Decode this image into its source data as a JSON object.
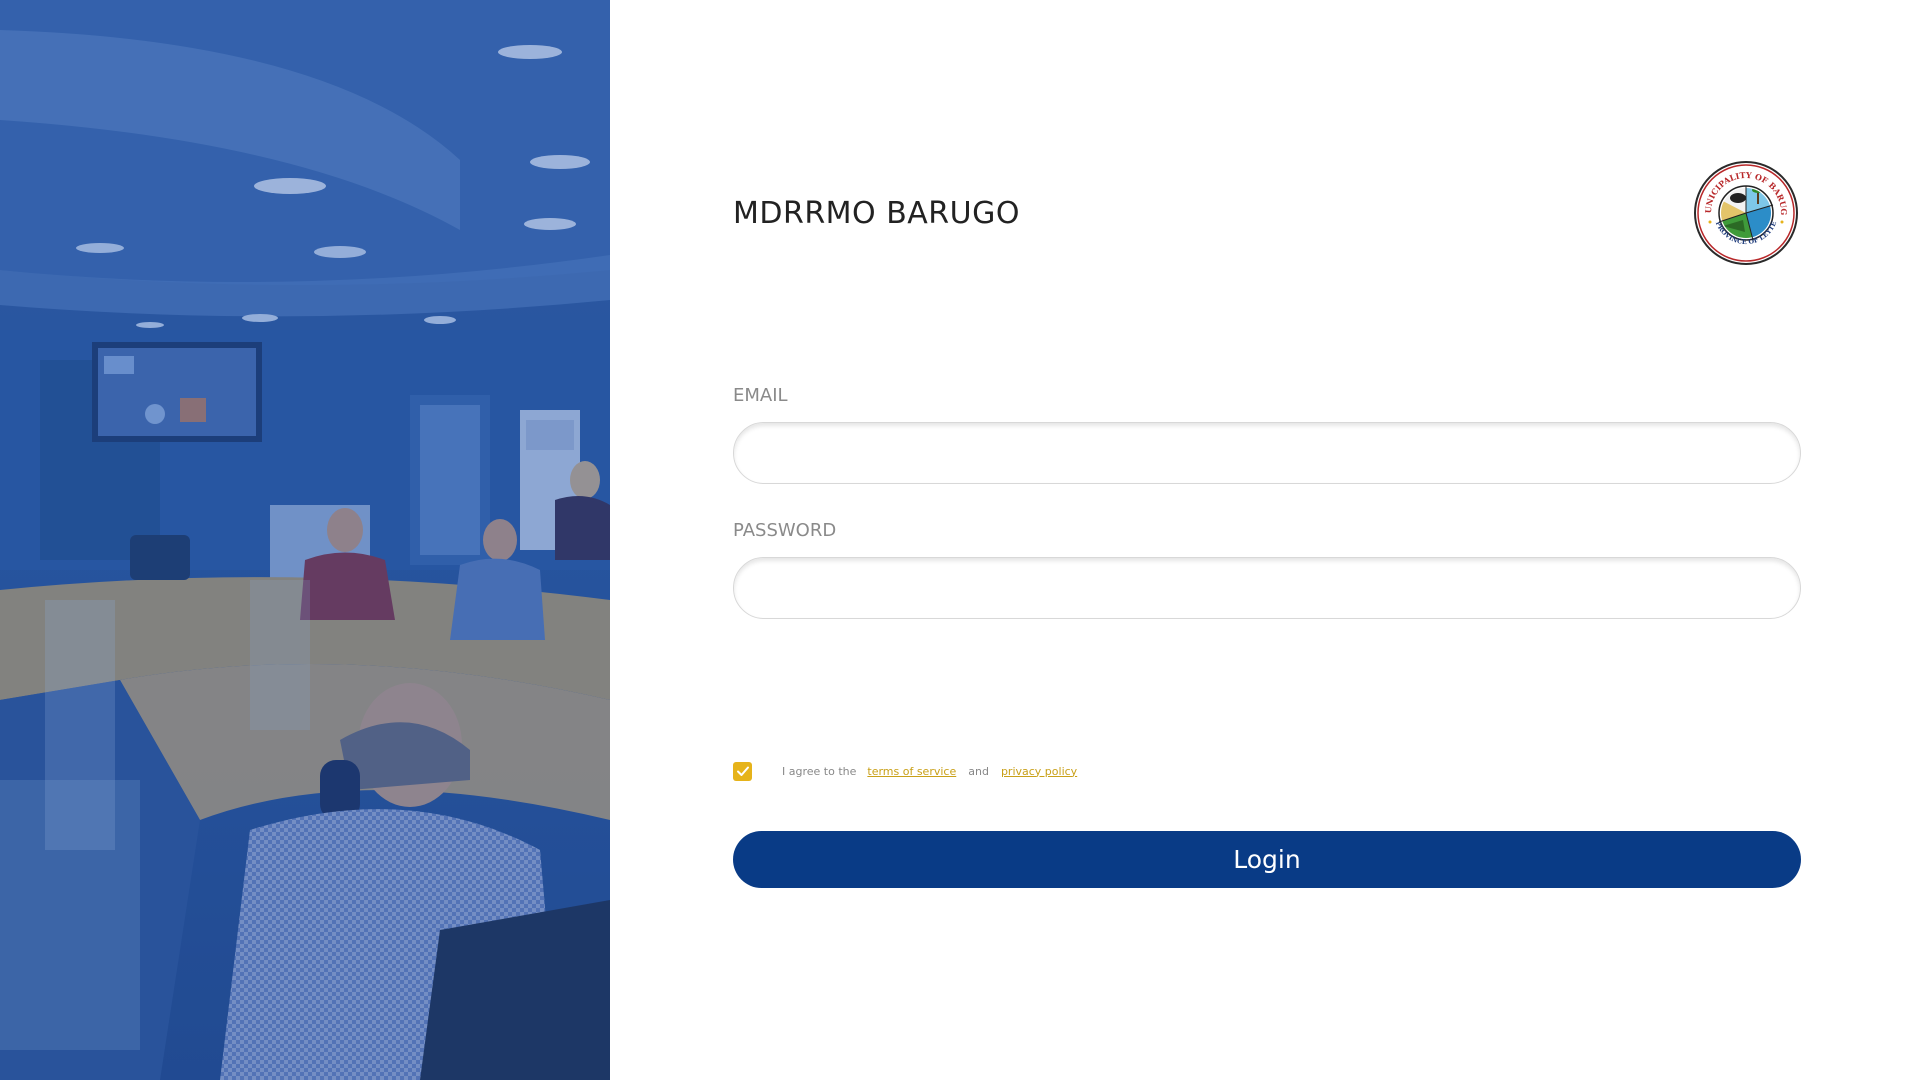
{
  "app": {
    "title": "MDRRMO BARUGO"
  },
  "form": {
    "email_label": "EMAIL",
    "email_value": "",
    "password_label": "PASSWORD",
    "password_value": "",
    "agree_prefix": "I agree to the",
    "terms_link": "terms of service",
    "agree_and": "and",
    "privacy_link": "privacy policy",
    "agree_checked": true,
    "login_label": "Login"
  },
  "seal": {
    "top_text": "MUNICIPALITY OF BARUGO",
    "bottom_text": "PROVINCE OF LEYTE"
  },
  "colors": {
    "primary": "#093b86",
    "accent": "#e6b31a",
    "link": "#c9a018",
    "photo_overlay": "#2f5aa0"
  },
  "icons": {
    "checkbox": "check-icon",
    "seal": "municipal-seal-icon"
  }
}
